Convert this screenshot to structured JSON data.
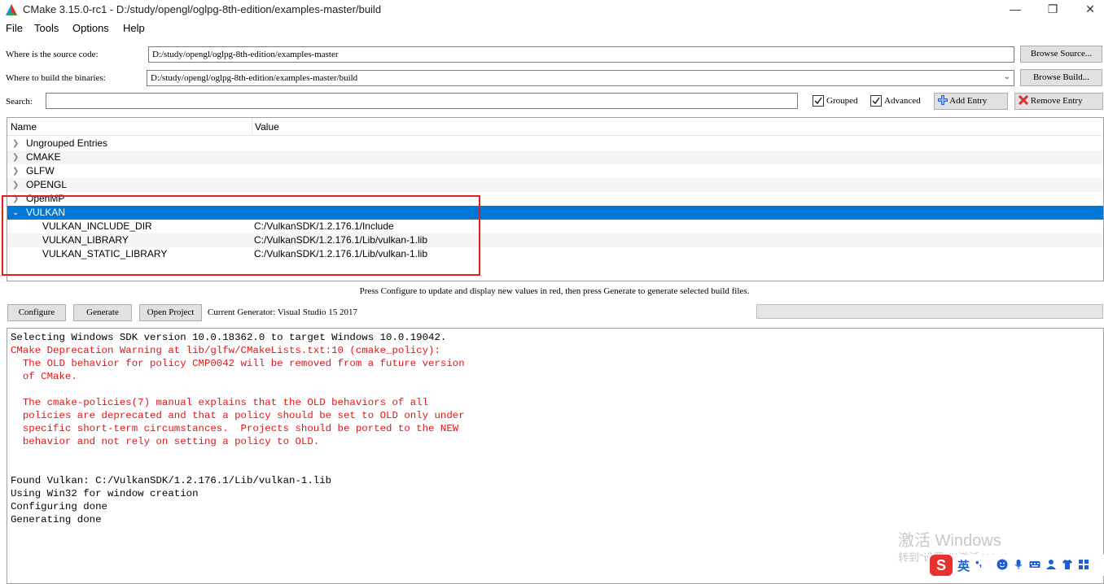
{
  "window": {
    "title": "CMake 3.15.0-rc1 - D:/study/opengl/oglpg-8th-edition/examples-master/build",
    "min_glyph": "—",
    "max_glyph": "❐",
    "close_glyph": "✕"
  },
  "menu": [
    "File",
    "Tools",
    "Options",
    "Help"
  ],
  "source": {
    "label": "Where is the source code:",
    "value": "D:/study/opengl/oglpg-8th-edition/examples-master",
    "browse_label": "Browse Source..."
  },
  "build": {
    "label": "Where to build the binaries:",
    "value": "D:/study/opengl/oglpg-8th-edition/examples-master/build",
    "browse_label": "Browse Build..."
  },
  "search": {
    "label": "Search:",
    "value": ""
  },
  "options": {
    "grouped_label": "Grouped",
    "grouped_checked": true,
    "advanced_label": "Advanced",
    "advanced_checked": true,
    "add_entry_label": "Add Entry",
    "remove_entry_label": "Remove Entry"
  },
  "tree": {
    "col_name": "Name",
    "col_value": "Value",
    "groups": [
      {
        "name": "Ungrouped Entries",
        "expanded": false
      },
      {
        "name": "CMAKE",
        "expanded": false
      },
      {
        "name": "GLFW",
        "expanded": false
      },
      {
        "name": "OPENGL",
        "expanded": false
      },
      {
        "name": "OpenMP",
        "expanded": false
      },
      {
        "name": "VULKAN",
        "expanded": true,
        "selected": true
      }
    ],
    "entries": [
      {
        "name": "VULKAN_INCLUDE_DIR",
        "value": "C:/VulkanSDK/1.2.176.1/Include"
      },
      {
        "name": "VULKAN_LIBRARY",
        "value": "C:/VulkanSDK/1.2.176.1/Lib/vulkan-1.lib"
      },
      {
        "name": "VULKAN_STATIC_LIBRARY",
        "value": "C:/VulkanSDK/1.2.176.1/Lib/vulkan-1.lib"
      }
    ]
  },
  "hint": "Press Configure to update and display new values in red, then press Generate to generate selected build files.",
  "actions": {
    "configure_label": "Configure",
    "generate_label": "Generate",
    "open_project_label": "Open Project",
    "generator_text": "Current Generator: Visual Studio 15 2017"
  },
  "progress": 0,
  "output": {
    "lines": [
      {
        "text": "Selecting Windows SDK version 10.0.18362.0 to target Windows 10.0.19042.",
        "type": "normal"
      },
      {
        "text": "CMake Deprecation Warning at lib/glfw/CMakeLists.txt:10 (cmake_policy):",
        "type": "warn"
      },
      {
        "text": "  The OLD behavior for policy CMP0042 will be removed from a future version",
        "type": "warn"
      },
      {
        "text": "  of CMake.",
        "type": "warn"
      },
      {
        "text": "",
        "type": "warn"
      },
      {
        "text": "  The cmake-policies(7) manual explains that the OLD behaviors of all",
        "type": "warn"
      },
      {
        "text": "  policies are deprecated and that a policy should be set to OLD only under",
        "type": "warn"
      },
      {
        "text": "  specific short-term circumstances.  Projects should be ported to the NEW",
        "type": "warn"
      },
      {
        "text": "  behavior and not rely on setting a policy to OLD.",
        "type": "warn"
      },
      {
        "text": "",
        "type": "normal"
      },
      {
        "text": "",
        "type": "normal"
      },
      {
        "text": "Found Vulkan: C:/VulkanSDK/1.2.176.1/Lib/vulkan-1.lib",
        "type": "normal"
      },
      {
        "text": "Using Win32 for window creation",
        "type": "normal"
      },
      {
        "text": "Configuring done",
        "type": "normal"
      },
      {
        "text": "Generating done",
        "type": "normal"
      }
    ]
  },
  "watermark": {
    "title": "激活 Windows",
    "subtitle": "转到\"设置\"以激活 Windows。"
  },
  "ime": {
    "logo": "S",
    "lang": "英",
    "punct": "•,"
  },
  "colors": {
    "selection": "#0078d7",
    "warning_text": "#e51414",
    "highlight_box": "#e02020"
  }
}
